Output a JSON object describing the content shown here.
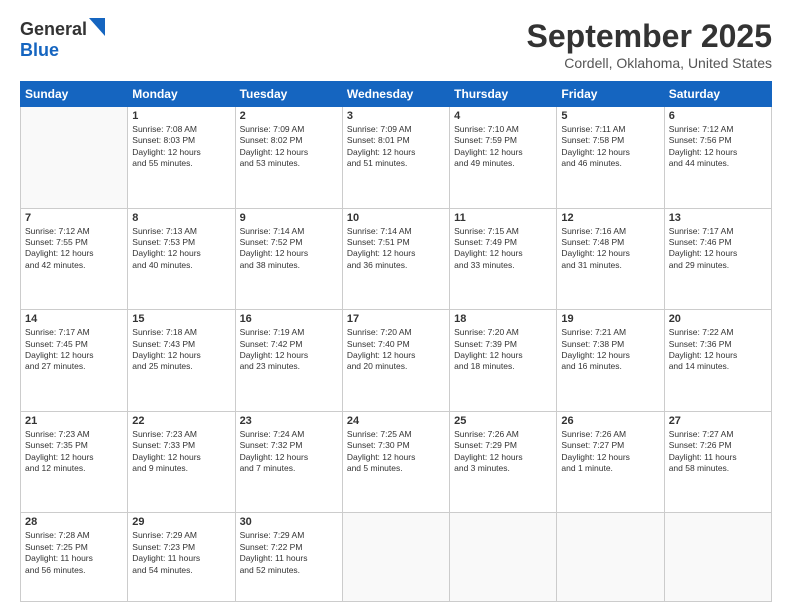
{
  "header": {
    "logo_general": "General",
    "logo_blue": "Blue",
    "month_title": "September 2025",
    "location": "Cordell, Oklahoma, United States"
  },
  "calendar": {
    "days_of_week": [
      "Sunday",
      "Monday",
      "Tuesday",
      "Wednesday",
      "Thursday",
      "Friday",
      "Saturday"
    ],
    "weeks": [
      [
        {
          "day": "",
          "info": ""
        },
        {
          "day": "1",
          "info": "Sunrise: 7:08 AM\nSunset: 8:03 PM\nDaylight: 12 hours\nand 55 minutes."
        },
        {
          "day": "2",
          "info": "Sunrise: 7:09 AM\nSunset: 8:02 PM\nDaylight: 12 hours\nand 53 minutes."
        },
        {
          "day": "3",
          "info": "Sunrise: 7:09 AM\nSunset: 8:01 PM\nDaylight: 12 hours\nand 51 minutes."
        },
        {
          "day": "4",
          "info": "Sunrise: 7:10 AM\nSunset: 7:59 PM\nDaylight: 12 hours\nand 49 minutes."
        },
        {
          "day": "5",
          "info": "Sunrise: 7:11 AM\nSunset: 7:58 PM\nDaylight: 12 hours\nand 46 minutes."
        },
        {
          "day": "6",
          "info": "Sunrise: 7:12 AM\nSunset: 7:56 PM\nDaylight: 12 hours\nand 44 minutes."
        }
      ],
      [
        {
          "day": "7",
          "info": "Sunrise: 7:12 AM\nSunset: 7:55 PM\nDaylight: 12 hours\nand 42 minutes."
        },
        {
          "day": "8",
          "info": "Sunrise: 7:13 AM\nSunset: 7:53 PM\nDaylight: 12 hours\nand 40 minutes."
        },
        {
          "day": "9",
          "info": "Sunrise: 7:14 AM\nSunset: 7:52 PM\nDaylight: 12 hours\nand 38 minutes."
        },
        {
          "day": "10",
          "info": "Sunrise: 7:14 AM\nSunset: 7:51 PM\nDaylight: 12 hours\nand 36 minutes."
        },
        {
          "day": "11",
          "info": "Sunrise: 7:15 AM\nSunset: 7:49 PM\nDaylight: 12 hours\nand 33 minutes."
        },
        {
          "day": "12",
          "info": "Sunrise: 7:16 AM\nSunset: 7:48 PM\nDaylight: 12 hours\nand 31 minutes."
        },
        {
          "day": "13",
          "info": "Sunrise: 7:17 AM\nSunset: 7:46 PM\nDaylight: 12 hours\nand 29 minutes."
        }
      ],
      [
        {
          "day": "14",
          "info": "Sunrise: 7:17 AM\nSunset: 7:45 PM\nDaylight: 12 hours\nand 27 minutes."
        },
        {
          "day": "15",
          "info": "Sunrise: 7:18 AM\nSunset: 7:43 PM\nDaylight: 12 hours\nand 25 minutes."
        },
        {
          "day": "16",
          "info": "Sunrise: 7:19 AM\nSunset: 7:42 PM\nDaylight: 12 hours\nand 23 minutes."
        },
        {
          "day": "17",
          "info": "Sunrise: 7:20 AM\nSunset: 7:40 PM\nDaylight: 12 hours\nand 20 minutes."
        },
        {
          "day": "18",
          "info": "Sunrise: 7:20 AM\nSunset: 7:39 PM\nDaylight: 12 hours\nand 18 minutes."
        },
        {
          "day": "19",
          "info": "Sunrise: 7:21 AM\nSunset: 7:38 PM\nDaylight: 12 hours\nand 16 minutes."
        },
        {
          "day": "20",
          "info": "Sunrise: 7:22 AM\nSunset: 7:36 PM\nDaylight: 12 hours\nand 14 minutes."
        }
      ],
      [
        {
          "day": "21",
          "info": "Sunrise: 7:23 AM\nSunset: 7:35 PM\nDaylight: 12 hours\nand 12 minutes."
        },
        {
          "day": "22",
          "info": "Sunrise: 7:23 AM\nSunset: 7:33 PM\nDaylight: 12 hours\nand 9 minutes."
        },
        {
          "day": "23",
          "info": "Sunrise: 7:24 AM\nSunset: 7:32 PM\nDaylight: 12 hours\nand 7 minutes."
        },
        {
          "day": "24",
          "info": "Sunrise: 7:25 AM\nSunset: 7:30 PM\nDaylight: 12 hours\nand 5 minutes."
        },
        {
          "day": "25",
          "info": "Sunrise: 7:26 AM\nSunset: 7:29 PM\nDaylight: 12 hours\nand 3 minutes."
        },
        {
          "day": "26",
          "info": "Sunrise: 7:26 AM\nSunset: 7:27 PM\nDaylight: 12 hours\nand 1 minute."
        },
        {
          "day": "27",
          "info": "Sunrise: 7:27 AM\nSunset: 7:26 PM\nDaylight: 11 hours\nand 58 minutes."
        }
      ],
      [
        {
          "day": "28",
          "info": "Sunrise: 7:28 AM\nSunset: 7:25 PM\nDaylight: 11 hours\nand 56 minutes."
        },
        {
          "day": "29",
          "info": "Sunrise: 7:29 AM\nSunset: 7:23 PM\nDaylight: 11 hours\nand 54 minutes."
        },
        {
          "day": "30",
          "info": "Sunrise: 7:29 AM\nSunset: 7:22 PM\nDaylight: 11 hours\nand 52 minutes."
        },
        {
          "day": "",
          "info": ""
        },
        {
          "day": "",
          "info": ""
        },
        {
          "day": "",
          "info": ""
        },
        {
          "day": "",
          "info": ""
        }
      ]
    ]
  }
}
